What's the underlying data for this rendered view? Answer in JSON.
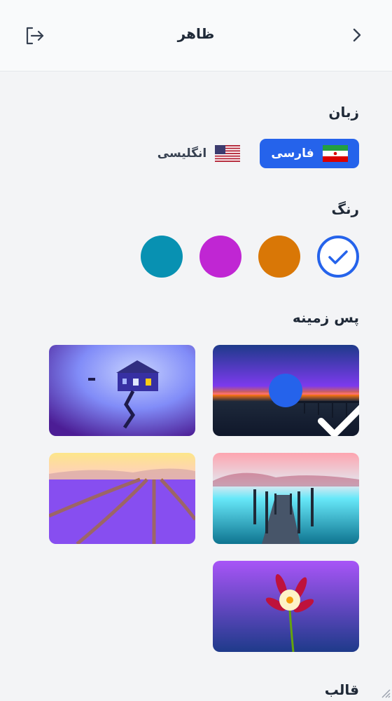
{
  "header": {
    "title": "ظاهر",
    "exit_icon": "exit-icon",
    "back_icon": "chevron-right-icon"
  },
  "sections": {
    "language": "زبان",
    "color": "رنگ",
    "background": "پس زمینه",
    "template": "قالب"
  },
  "languages": [
    {
      "label": "فارسی",
      "flag": "iran-flag-icon",
      "selected": true
    },
    {
      "label": "انگلیسی",
      "flag": "us-flag-icon",
      "selected": false
    }
  ],
  "colors": [
    {
      "name": "blue",
      "hex": "#2563eb",
      "selected": true
    },
    {
      "name": "orange",
      "hex": "#d97706",
      "selected": false
    },
    {
      "name": "magenta",
      "hex": "#c026d3",
      "selected": false
    },
    {
      "name": "teal",
      "hex": "#0891b2",
      "selected": false
    }
  ],
  "backgrounds": [
    {
      "name": "sunset-pier",
      "selected": true
    },
    {
      "name": "lake-house",
      "selected": false
    },
    {
      "name": "misty-jetty",
      "selected": false
    },
    {
      "name": "lavender-field",
      "selected": false
    },
    {
      "name": "flower",
      "selected": false
    }
  ],
  "accent": "#2563eb"
}
